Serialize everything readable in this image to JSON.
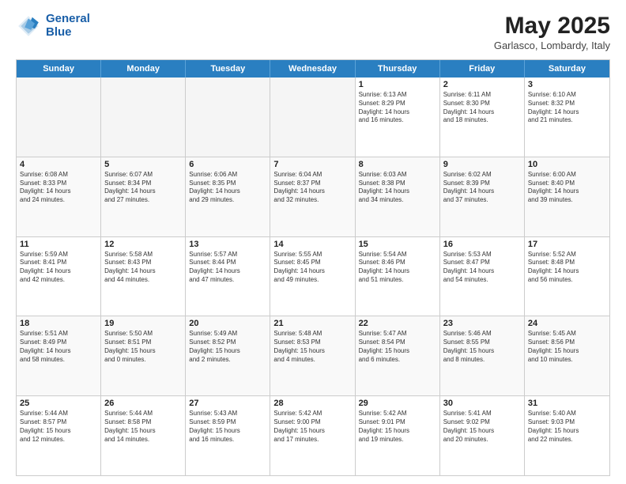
{
  "header": {
    "logo_line1": "General",
    "logo_line2": "Blue",
    "month": "May 2025",
    "location": "Garlasco, Lombardy, Italy"
  },
  "days_of_week": [
    "Sunday",
    "Monday",
    "Tuesday",
    "Wednesday",
    "Thursday",
    "Friday",
    "Saturday"
  ],
  "weeks": [
    [
      {
        "day": "",
        "info": ""
      },
      {
        "day": "",
        "info": ""
      },
      {
        "day": "",
        "info": ""
      },
      {
        "day": "",
        "info": ""
      },
      {
        "day": "1",
        "info": "Sunrise: 6:13 AM\nSunset: 8:29 PM\nDaylight: 14 hours\nand 16 minutes."
      },
      {
        "day": "2",
        "info": "Sunrise: 6:11 AM\nSunset: 8:30 PM\nDaylight: 14 hours\nand 18 minutes."
      },
      {
        "day": "3",
        "info": "Sunrise: 6:10 AM\nSunset: 8:32 PM\nDaylight: 14 hours\nand 21 minutes."
      }
    ],
    [
      {
        "day": "4",
        "info": "Sunrise: 6:08 AM\nSunset: 8:33 PM\nDaylight: 14 hours\nand 24 minutes."
      },
      {
        "day": "5",
        "info": "Sunrise: 6:07 AM\nSunset: 8:34 PM\nDaylight: 14 hours\nand 27 minutes."
      },
      {
        "day": "6",
        "info": "Sunrise: 6:06 AM\nSunset: 8:35 PM\nDaylight: 14 hours\nand 29 minutes."
      },
      {
        "day": "7",
        "info": "Sunrise: 6:04 AM\nSunset: 8:37 PM\nDaylight: 14 hours\nand 32 minutes."
      },
      {
        "day": "8",
        "info": "Sunrise: 6:03 AM\nSunset: 8:38 PM\nDaylight: 14 hours\nand 34 minutes."
      },
      {
        "day": "9",
        "info": "Sunrise: 6:02 AM\nSunset: 8:39 PM\nDaylight: 14 hours\nand 37 minutes."
      },
      {
        "day": "10",
        "info": "Sunrise: 6:00 AM\nSunset: 8:40 PM\nDaylight: 14 hours\nand 39 minutes."
      }
    ],
    [
      {
        "day": "11",
        "info": "Sunrise: 5:59 AM\nSunset: 8:41 PM\nDaylight: 14 hours\nand 42 minutes."
      },
      {
        "day": "12",
        "info": "Sunrise: 5:58 AM\nSunset: 8:43 PM\nDaylight: 14 hours\nand 44 minutes."
      },
      {
        "day": "13",
        "info": "Sunrise: 5:57 AM\nSunset: 8:44 PM\nDaylight: 14 hours\nand 47 minutes."
      },
      {
        "day": "14",
        "info": "Sunrise: 5:55 AM\nSunset: 8:45 PM\nDaylight: 14 hours\nand 49 minutes."
      },
      {
        "day": "15",
        "info": "Sunrise: 5:54 AM\nSunset: 8:46 PM\nDaylight: 14 hours\nand 51 minutes."
      },
      {
        "day": "16",
        "info": "Sunrise: 5:53 AM\nSunset: 8:47 PM\nDaylight: 14 hours\nand 54 minutes."
      },
      {
        "day": "17",
        "info": "Sunrise: 5:52 AM\nSunset: 8:48 PM\nDaylight: 14 hours\nand 56 minutes."
      }
    ],
    [
      {
        "day": "18",
        "info": "Sunrise: 5:51 AM\nSunset: 8:49 PM\nDaylight: 14 hours\nand 58 minutes."
      },
      {
        "day": "19",
        "info": "Sunrise: 5:50 AM\nSunset: 8:51 PM\nDaylight: 15 hours\nand 0 minutes."
      },
      {
        "day": "20",
        "info": "Sunrise: 5:49 AM\nSunset: 8:52 PM\nDaylight: 15 hours\nand 2 minutes."
      },
      {
        "day": "21",
        "info": "Sunrise: 5:48 AM\nSunset: 8:53 PM\nDaylight: 15 hours\nand 4 minutes."
      },
      {
        "day": "22",
        "info": "Sunrise: 5:47 AM\nSunset: 8:54 PM\nDaylight: 15 hours\nand 6 minutes."
      },
      {
        "day": "23",
        "info": "Sunrise: 5:46 AM\nSunset: 8:55 PM\nDaylight: 15 hours\nand 8 minutes."
      },
      {
        "day": "24",
        "info": "Sunrise: 5:45 AM\nSunset: 8:56 PM\nDaylight: 15 hours\nand 10 minutes."
      }
    ],
    [
      {
        "day": "25",
        "info": "Sunrise: 5:44 AM\nSunset: 8:57 PM\nDaylight: 15 hours\nand 12 minutes."
      },
      {
        "day": "26",
        "info": "Sunrise: 5:44 AM\nSunset: 8:58 PM\nDaylight: 15 hours\nand 14 minutes."
      },
      {
        "day": "27",
        "info": "Sunrise: 5:43 AM\nSunset: 8:59 PM\nDaylight: 15 hours\nand 16 minutes."
      },
      {
        "day": "28",
        "info": "Sunrise: 5:42 AM\nSunset: 9:00 PM\nDaylight: 15 hours\nand 17 minutes."
      },
      {
        "day": "29",
        "info": "Sunrise: 5:42 AM\nSunset: 9:01 PM\nDaylight: 15 hours\nand 19 minutes."
      },
      {
        "day": "30",
        "info": "Sunrise: 5:41 AM\nSunset: 9:02 PM\nDaylight: 15 hours\nand 20 minutes."
      },
      {
        "day": "31",
        "info": "Sunrise: 5:40 AM\nSunset: 9:03 PM\nDaylight: 15 hours\nand 22 minutes."
      }
    ]
  ]
}
